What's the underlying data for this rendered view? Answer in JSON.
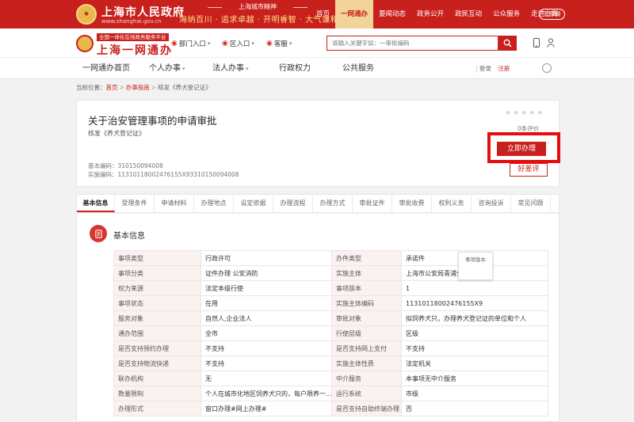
{
  "top_bar": {
    "site_name": "上海市人民政府",
    "site_domain": "www.shanghai.gov.cn",
    "spirit_title": "上海城市精神",
    "spirit_text": "海纳百川 · 追求卓越 · 开明睿智 · 大气谦和",
    "nav": [
      "首页",
      "一网通办",
      "要闻动态",
      "政务公开",
      "政民互动",
      "公众服务",
      "走进上海"
    ],
    "barrier_free": "无障碍"
  },
  "header": {
    "slogan": "全国一体化在线政务服务平台",
    "brand": "上海一网通办",
    "entries": [
      "部门入口",
      "区入口",
      "客服"
    ],
    "search_placeholder": "请输入关键字如：一审批编码"
  },
  "main_nav": {
    "items": [
      "一网通办首页",
      "个人办事",
      "法人办事",
      "行政权力",
      "公共服务"
    ],
    "login": "登录",
    "register": "注册"
  },
  "breadcrumb": {
    "label": "当前位置：",
    "items": [
      "首页",
      "办事指南",
      "核发《养犬登记证》"
    ]
  },
  "item": {
    "title": "关于治安管理事项的申请审批",
    "subtitle": "核发《养犬登记证》",
    "basic_code": "基本编码：310150094008",
    "impl_code": "实施编码：11310118002476155X93310150094008",
    "rating_count": "0条评价",
    "apply_label": "立即办理",
    "review_label": "好差评"
  },
  "tabs": [
    "基本信息",
    "受理条件",
    "申请材料",
    "办理地点",
    "设定依据",
    "办理流程",
    "办理方式",
    "审批证件",
    "审批收费",
    "权利义务",
    "咨询投诉",
    "常见问题"
  ],
  "active_tab": 0,
  "section": {
    "title": "基本信息",
    "tooltip": "事项版本",
    "rows": [
      [
        "事项类型",
        "行政许可",
        "办件类型",
        "承诺件"
      ],
      [
        "事项分类",
        "证件办理 公安消防",
        "实施主体",
        "上海市公安局青浦分局"
      ],
      [
        "权力来源",
        "法定本级行使",
        "事项版本",
        "1"
      ],
      [
        "事项状态",
        "在用",
        "实施主体编码",
        "11310118002476155X9"
      ],
      [
        "服务对象",
        "自然人,企业法人",
        "审批对象",
        "拟饲养犬只，办理养犬登记证的单位和个人"
      ],
      [
        "通办范围",
        "全市",
        "行使层级",
        "区级"
      ],
      [
        "是否支持预约办理",
        "不支持",
        "是否支持网上支付",
        "不支持"
      ],
      [
        "是否支持物流快递",
        "不支持",
        "实施主体性质",
        "法定机关"
      ],
      [
        "联办机构",
        "无",
        "中介服务",
        "本事项无中介服务"
      ],
      [
        "数量限制",
        "个人在城市化地区饲养犬只的，每户限养一...",
        "运行系统",
        "市级"
      ],
      [
        "办理形式",
        "窗口办理#网上办理#",
        "是否支持自助终端办理",
        "否"
      ]
    ]
  },
  "colors": {
    "brand_red": "#c8201c",
    "highlight": "#e50d0d",
    "nav_active_bg": "#f2d49a"
  }
}
